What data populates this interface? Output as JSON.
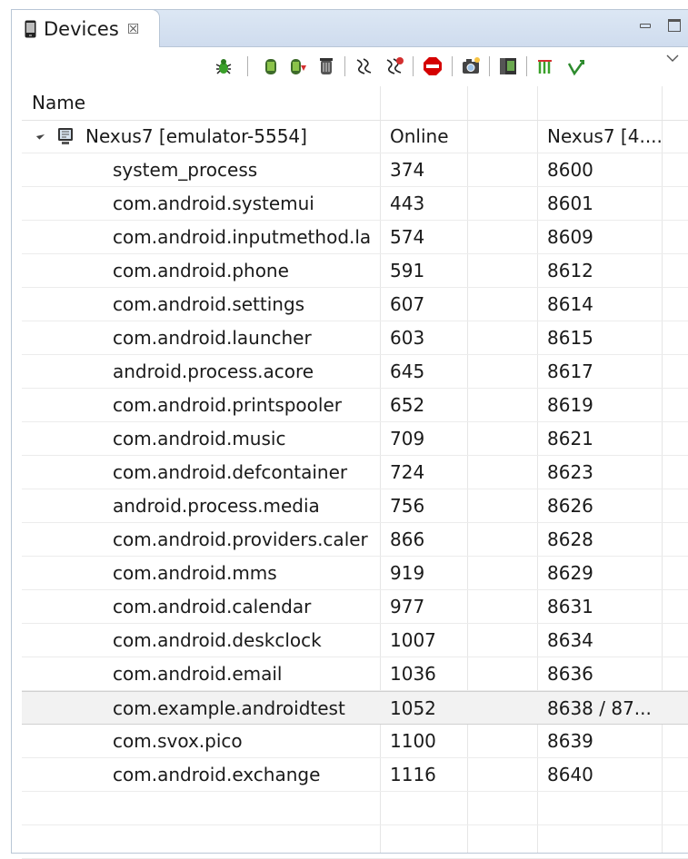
{
  "view": {
    "tab_title": "Devices",
    "tab_close": "☒"
  },
  "table": {
    "header_name": "Name",
    "device": {
      "name": "Nexus7 [emulator-5554]",
      "status": "Online",
      "info": "Nexus7 [4...."
    },
    "processes": [
      {
        "name": "system_process",
        "pid": "374",
        "port": "8600"
      },
      {
        "name": "com.android.systemui",
        "pid": "443",
        "port": "8601"
      },
      {
        "name": "com.android.inputmethod.la",
        "pid": "574",
        "port": "8609"
      },
      {
        "name": "com.android.phone",
        "pid": "591",
        "port": "8612"
      },
      {
        "name": "com.android.settings",
        "pid": "607",
        "port": "8614"
      },
      {
        "name": "com.android.launcher",
        "pid": "603",
        "port": "8615"
      },
      {
        "name": "android.process.acore",
        "pid": "645",
        "port": "8617"
      },
      {
        "name": "com.android.printspooler",
        "pid": "652",
        "port": "8619"
      },
      {
        "name": "com.android.music",
        "pid": "709",
        "port": "8621"
      },
      {
        "name": "com.android.defcontainer",
        "pid": "724",
        "port": "8623"
      },
      {
        "name": "android.process.media",
        "pid": "756",
        "port": "8626"
      },
      {
        "name": "com.android.providers.caler",
        "pid": "866",
        "port": "8628"
      },
      {
        "name": "com.android.mms",
        "pid": "919",
        "port": "8629"
      },
      {
        "name": "com.android.calendar",
        "pid": "977",
        "port": "8631"
      },
      {
        "name": "com.android.deskclock",
        "pid": "1007",
        "port": "8634"
      },
      {
        "name": "com.android.email",
        "pid": "1036",
        "port": "8636"
      },
      {
        "name": "com.example.androidtest",
        "pid": "1052",
        "port": "8638 / 87..."
      },
      {
        "name": "com.svox.pico",
        "pid": "1100",
        "port": "8639"
      },
      {
        "name": "com.android.exchange",
        "pid": "1116",
        "port": "8640"
      }
    ],
    "selected_index": 16
  },
  "icons": {
    "tab": "mobile-device-icon",
    "toolbar": [
      "debug-process-icon",
      "update-heap-icon",
      "dump-hprof-icon",
      "cause-gc-icon",
      "update-threads-icon",
      "start-method-profiling-icon",
      "stop-process-icon",
      "screen-capture-icon",
      "dump-view-hierarchy-icon",
      "capture-opengl-trace-icon",
      "systrace-icon"
    ]
  },
  "colors": {
    "tab_bar": "#cfdcee",
    "border": "#b9c6d6",
    "selected_row": "#f2f2f2"
  }
}
